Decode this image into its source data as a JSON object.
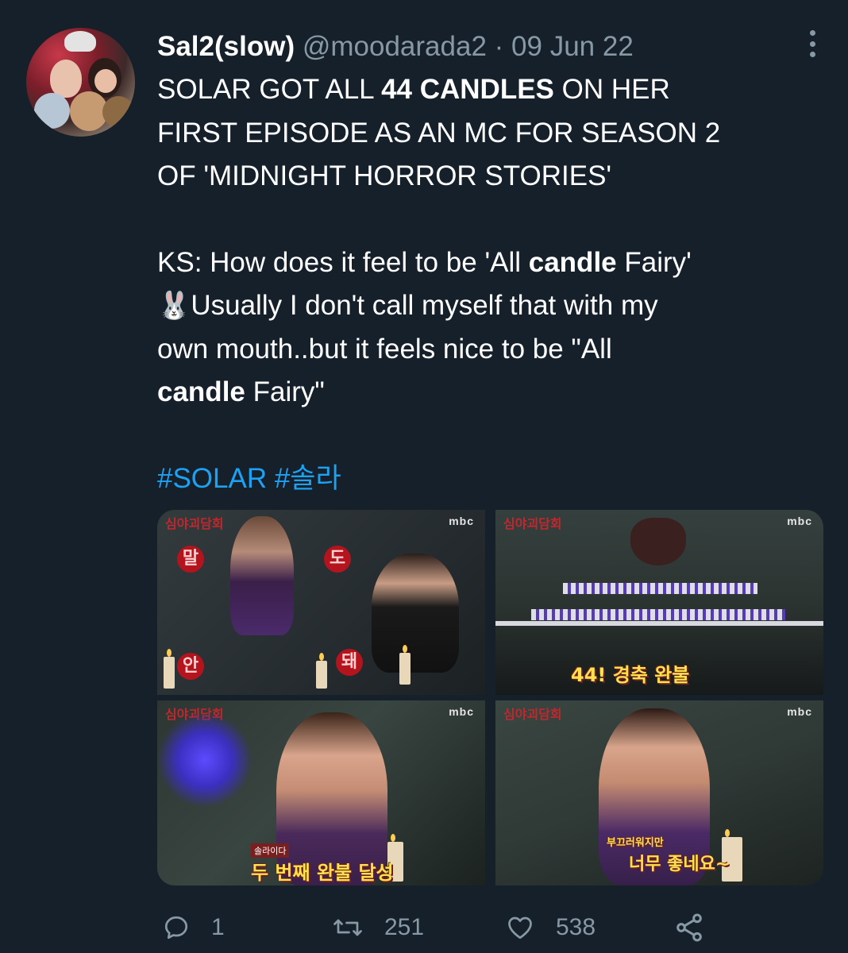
{
  "tweet": {
    "display_name": "Sal2(slow)",
    "handle": "@moodarada2",
    "separator": "·",
    "date": "09 Jun 22",
    "text": {
      "line1_pre": "SOLAR GOT ALL ",
      "line1_bold": "44 CANDLES",
      "line1_post": " ON HER",
      "line2": "FIRST EPISODE AS AN MC FOR SEASON 2",
      "line3": "OF 'MIDNIGHT HORROR STORIES'",
      "ks_pre": "KS: How does it feel to be 'All ",
      "ks_bold": "candle",
      "ks_post": " Fairy'",
      "rabbit_emoji": "🐰",
      "reply1": "Usually I don't call myself that with my",
      "reply2": "own mouth..but it feels nice to be \"All",
      "reply3_bold": "candle",
      "reply3_post": " Fairy\""
    },
    "hashtags": "#SOLAR #솔라",
    "media": {
      "watermark": "mbc",
      "frame2_caption": "44! 경축 완불",
      "frame3_caption": "두 번째 완불 달성",
      "frame3_sub": "솔라이다",
      "frame4_caption_top": "부끄러워지만",
      "frame4_caption": "너무 좋네요~",
      "frame1_blobs": [
        "말",
        "도",
        "안",
        "돼"
      ]
    },
    "actions": {
      "replies": "1",
      "retweets": "251",
      "likes": "538"
    },
    "colors": {
      "background": "#15202b",
      "secondary_text": "#8899a6",
      "link": "#1da1f2"
    }
  }
}
